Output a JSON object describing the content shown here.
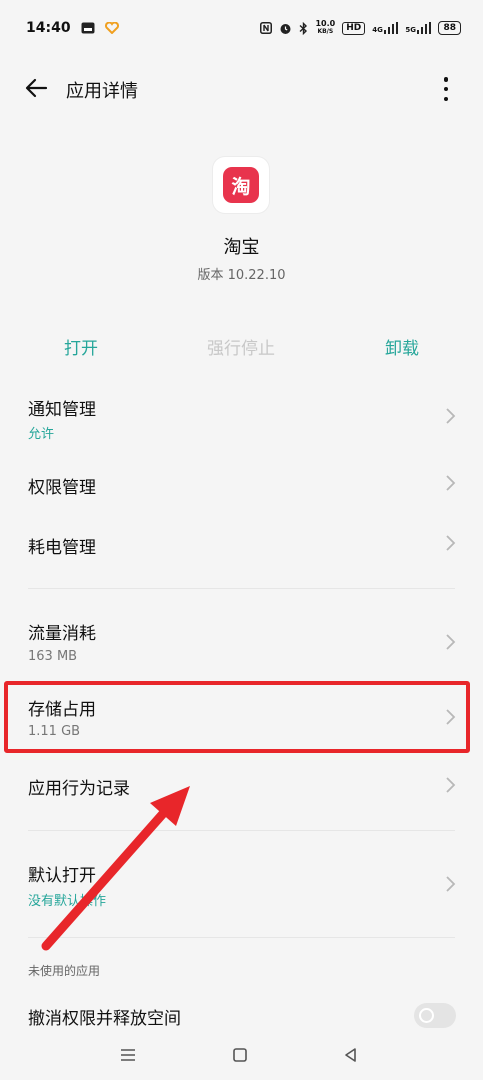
{
  "status_bar": {
    "time": "14:40",
    "net_speed_value": "10.0",
    "net_speed_unit": "KB/S",
    "hd_label": "HD",
    "network_4g": "4G",
    "network_5g": "5G",
    "battery": "88"
  },
  "header": {
    "title": "应用详情"
  },
  "app": {
    "name": "淘宝",
    "icon_glyph": "淘",
    "version": "版本 10.22.10",
    "icon_color": "#e8344d"
  },
  "actions": {
    "open": "打开",
    "force_stop": "强行停止",
    "uninstall": "卸载"
  },
  "settings": {
    "notifications": {
      "title": "通知管理",
      "sub": "允许"
    },
    "permissions": {
      "title": "权限管理"
    },
    "battery": {
      "title": "耗电管理"
    },
    "data_usage": {
      "title": "流量消耗",
      "sub": "163 MB"
    },
    "storage": {
      "title": "存储占用",
      "sub": "1.11 GB"
    },
    "behavior": {
      "title": "应用行为记录"
    },
    "default_open": {
      "title": "默认打开",
      "sub": "没有默认操作"
    }
  },
  "unused_section": {
    "label": "未使用的应用",
    "revoke_title": "撤消权限并释放空间",
    "revoke_enabled": false
  },
  "colors": {
    "accent": "#26a69a",
    "highlight": "#e8262a",
    "disabled": "#c8c8c8"
  }
}
